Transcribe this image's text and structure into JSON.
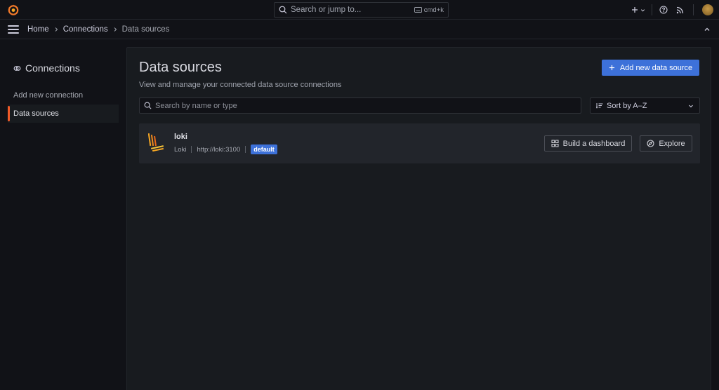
{
  "topbar": {
    "search_placeholder": "Search or jump to...",
    "shortcut": "cmd+k",
    "icons": [
      "grafana-logo-icon",
      "search-icon",
      "keyboard-icon",
      "plus-icon",
      "chevron-down-icon",
      "help-icon",
      "rss-icon",
      "avatar"
    ]
  },
  "breadcrumb": {
    "home": "Home",
    "connections": "Connections",
    "current": "Data sources"
  },
  "sidebar": {
    "title": "Connections",
    "items": [
      {
        "label": "Add new connection",
        "active": false
      },
      {
        "label": "Data sources",
        "active": true
      }
    ]
  },
  "main": {
    "title": "Data sources",
    "subtitle": "View and manage your connected data source connections",
    "add_button": "Add new data source",
    "search_placeholder": "Search by name or type",
    "sort_label": "Sort by A–Z",
    "datasources": [
      {
        "name": "loki",
        "type": "Loki",
        "url": "http://loki:3100",
        "badge": "default",
        "build_button": "Build a dashboard",
        "explore_button": "Explore"
      }
    ]
  },
  "colors": {
    "accent_blue": "#3d71d9",
    "active_orange": "#f05a28",
    "background": "#111217",
    "panel": "#181b1f",
    "card": "#22252b"
  }
}
